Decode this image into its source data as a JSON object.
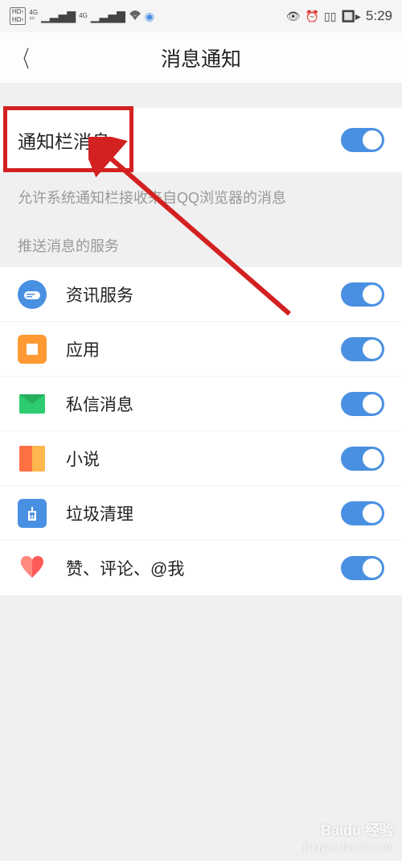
{
  "status_bar": {
    "time": "5:29"
  },
  "header": {
    "title": "消息通知"
  },
  "main_toggle": {
    "label": "通知栏消息",
    "on": true
  },
  "description": "允许系统通知栏接收来自QQ浏览器的消息",
  "section_title": "推送消息的服务",
  "items": [
    {
      "icon": "news-icon",
      "label": "资讯服务",
      "on": true
    },
    {
      "icon": "app-icon",
      "label": "应用",
      "on": true
    },
    {
      "icon": "message-icon",
      "label": "私信消息",
      "on": true
    },
    {
      "icon": "novel-icon",
      "label": "小说",
      "on": true
    },
    {
      "icon": "clean-icon",
      "label": "垃圾清理",
      "on": true
    },
    {
      "icon": "like-icon",
      "label": "赞、评论、@我",
      "on": true
    }
  ],
  "watermark": {
    "brand": "Baidu 经验",
    "sub": "jingyan.baidu.com"
  },
  "annotation": {
    "highlight_target": "通知栏消息",
    "arrow_color": "#d32020"
  }
}
